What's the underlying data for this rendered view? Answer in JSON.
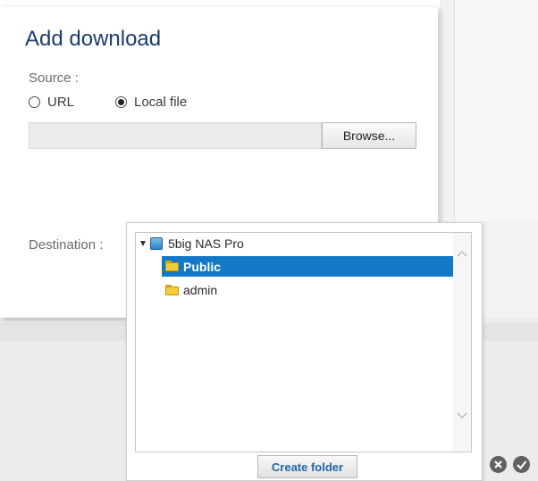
{
  "dialog": {
    "title": "Add download",
    "source_label": "Source :",
    "source_options": [
      {
        "label": "URL",
        "selected": false
      },
      {
        "label": "Local file",
        "selected": true
      }
    ],
    "file_field_value": "",
    "browse_label": "Browse...",
    "destination_label": "Destination :"
  },
  "tree": {
    "root": {
      "label": "5big NAS Pro",
      "icon": "nas-drive-icon",
      "expanded": true
    },
    "children": [
      {
        "label": "Public",
        "icon": "folder-icon",
        "selected": true
      },
      {
        "label": "admin",
        "icon": "folder-icon",
        "selected": false
      }
    ],
    "create_folder_label": "Create folder"
  },
  "actions": {
    "cancel_icon": "cancel-icon",
    "confirm_icon": "confirm-icon"
  },
  "colors": {
    "title": "#1d3c6e",
    "selection": "#1379c7",
    "create_folder_text": "#2366a8",
    "action_icon": "#616161"
  }
}
